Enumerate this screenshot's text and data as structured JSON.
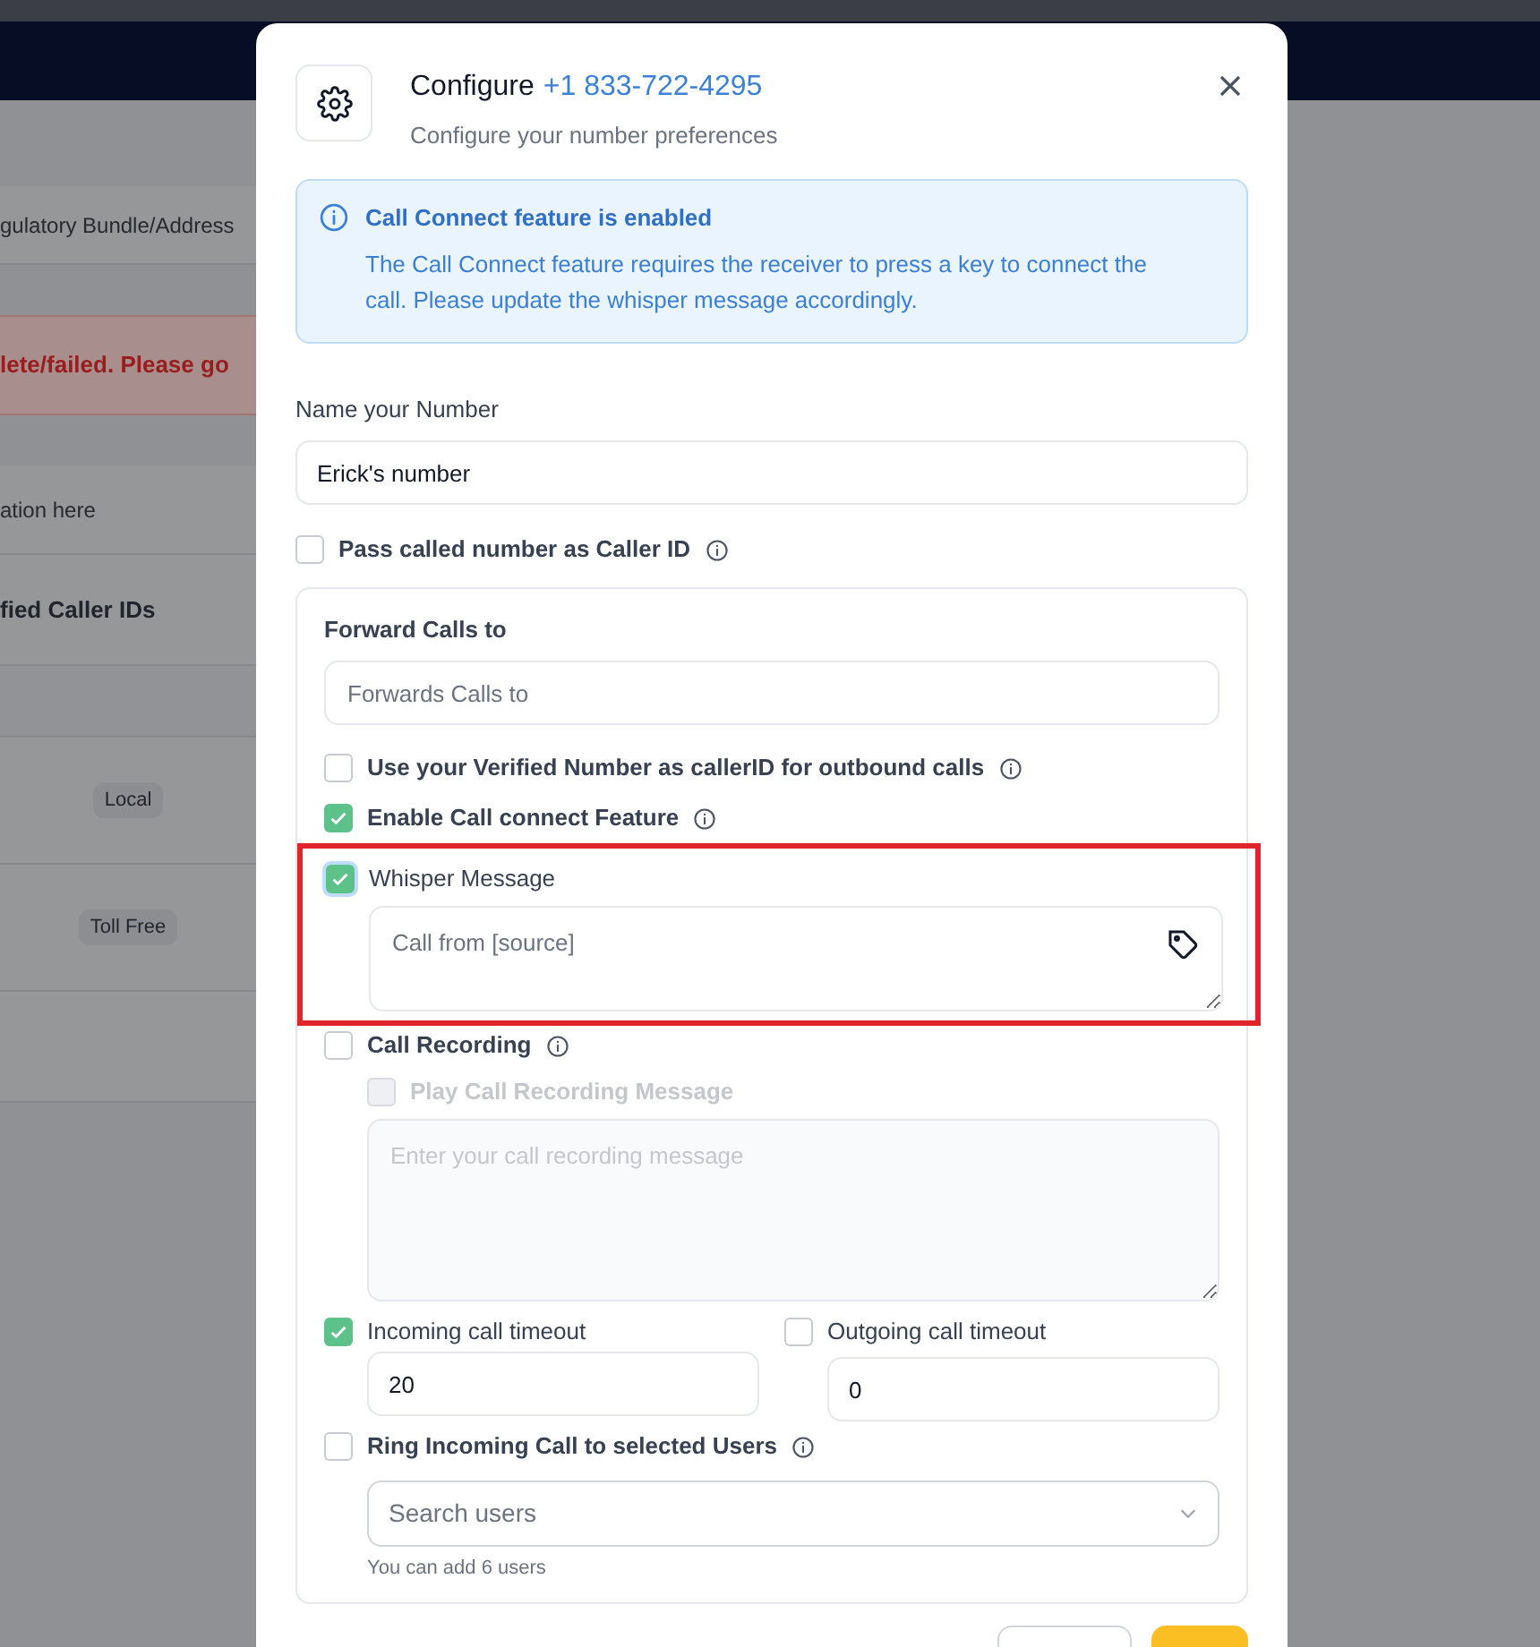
{
  "background": {
    "rows": [
      {
        "kind": "text",
        "text": "gulatory Bundle/Address"
      },
      {
        "kind": "error",
        "text": "lete/failed. Please go"
      },
      {
        "kind": "text",
        "text": "ation here"
      },
      {
        "kind": "heading",
        "text": "fied Caller IDs"
      },
      {
        "kind": "spacer"
      },
      {
        "kind": "badge",
        "text": "Local"
      },
      {
        "kind": "badge",
        "text": "Toll Free"
      },
      {
        "kind": "spacer"
      }
    ]
  },
  "dialog": {
    "title": "Configure",
    "phone": "+1 833-722-4295",
    "subtitle": "Configure your number preferences",
    "alert": {
      "title": "Call Connect feature is enabled",
      "body": "The Call Connect feature requires the receiver to press a key to connect the call. Please update the whisper message accordingly."
    },
    "name_label": "Name your Number",
    "name_value": "Erick's number",
    "pass_caller_id": {
      "label": "Pass called number as Caller ID",
      "checked": false
    },
    "forward": {
      "label": "Forward Calls to",
      "placeholder": "Forwards Calls to"
    },
    "use_verified": {
      "label": "Use your Verified Number as callerID for outbound calls",
      "checked": false
    },
    "call_connect": {
      "label": "Enable Call connect Feature",
      "checked": true
    },
    "whisper": {
      "label": "Whisper Message",
      "checked": true,
      "highlighted": true,
      "placeholder": "Call from [source]"
    },
    "call_recording": {
      "label": "Call Recording",
      "checked": false
    },
    "play_recording": {
      "label": "Play Call Recording Message",
      "checked": false,
      "disabled": true,
      "placeholder": "Enter your call recording message"
    },
    "incoming_timeout": {
      "label": "Incoming call timeout",
      "checked": true,
      "value": "20"
    },
    "outgoing_timeout": {
      "label": "Outgoing call timeout",
      "checked": false,
      "value": "0"
    },
    "ring_users": {
      "label": "Ring Incoming Call to selected Users",
      "checked": false,
      "placeholder": "Search users",
      "hint": "You can add 6 users"
    }
  }
}
